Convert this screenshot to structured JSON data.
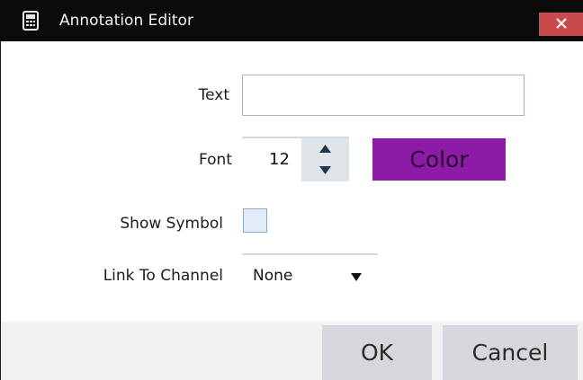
{
  "window": {
    "title": "Annotation Editor",
    "close_glyph": "×"
  },
  "form": {
    "text_label": "Text",
    "text_value": "",
    "font_label": "Font",
    "font_value": "12",
    "color_label": "Color",
    "color_value": "#8e1ba8",
    "show_symbol_label": "Show Symbol",
    "show_symbol_checked": false,
    "link_label": "Link To Channel",
    "link_value": "None"
  },
  "footer": {
    "ok_label": "OK",
    "cancel_label": "Cancel"
  },
  "icons": {
    "app": "calculator-icon",
    "close": "close-icon",
    "spin_up": "triangle-up-icon",
    "spin_down": "triangle-down-icon",
    "dropdown": "triangle-down-icon"
  }
}
